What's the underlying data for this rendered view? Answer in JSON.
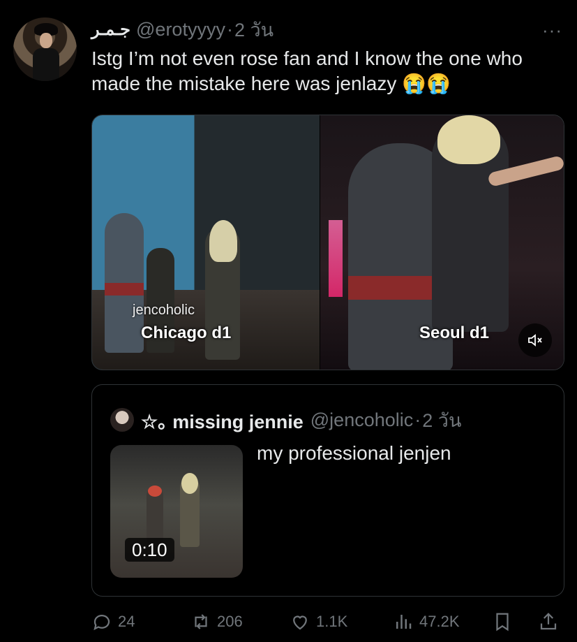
{
  "tweet": {
    "display_name": "جـمـر",
    "handle": "@erotyyyy",
    "time": "2 วัน",
    "text": "Istg I’m not even rose fan and I know the one who made the mistake here was jenlazy 😭😭"
  },
  "media": {
    "watermark": "jencoholic",
    "left_label": "Chicago d1",
    "right_label": "Seoul d1"
  },
  "quote": {
    "display_name": "☆｡ missing jennie",
    "handle": "@jencoholic",
    "time": "2 วัน",
    "text": "my professional jenjen",
    "video_time": "0:10"
  },
  "actions": {
    "replies": "24",
    "retweets": "206",
    "likes": "1.1K",
    "views": "47.2K"
  }
}
